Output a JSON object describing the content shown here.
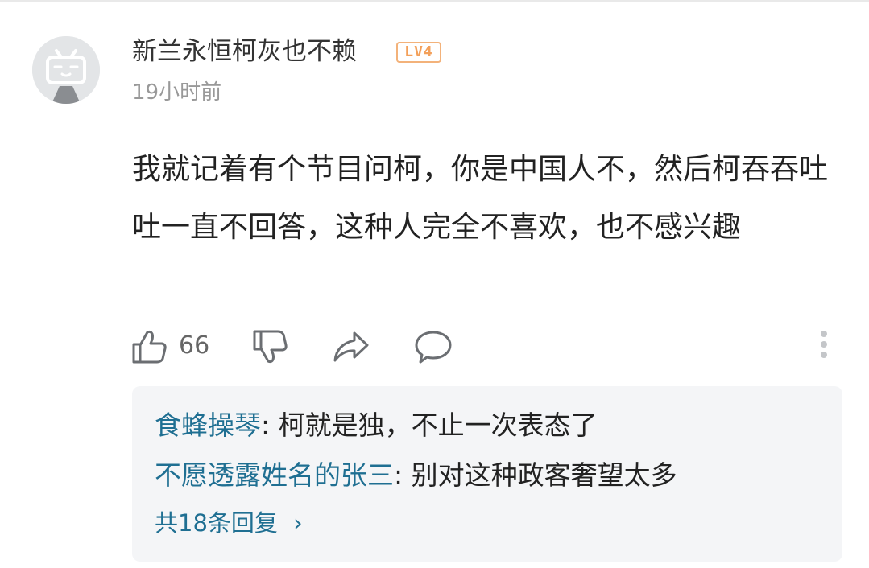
{
  "comment": {
    "username": "新兰永恒柯灰也不赖",
    "level_badge": "LV4",
    "timestamp": "19小时前",
    "text": "我就记着有个节目问柯，你是中国人不，然后柯吞吞吐吐一直不回答，这种人完全不喜欢，也不感兴趣",
    "like_count": "66"
  },
  "actions": {
    "icons": [
      "thumbs-up-icon",
      "thumbs-down-icon",
      "share-icon",
      "comment-bubble-icon",
      "more-vertical-icon"
    ]
  },
  "replies": {
    "items": [
      {
        "user": "食蜂操琴",
        "separator": ": ",
        "text": "柯就是独，不止一次表态了"
      },
      {
        "user": "不愿透露姓名的张三",
        "separator": ": ",
        "text": "别对这种政客奢望太多"
      }
    ],
    "more_label": "共18条回复",
    "more_chevron": "›"
  },
  "colors": {
    "link": "#1f6f92",
    "badge": "#f3a05a",
    "reply_bg": "#f4f5f7",
    "muted": "#999999"
  }
}
